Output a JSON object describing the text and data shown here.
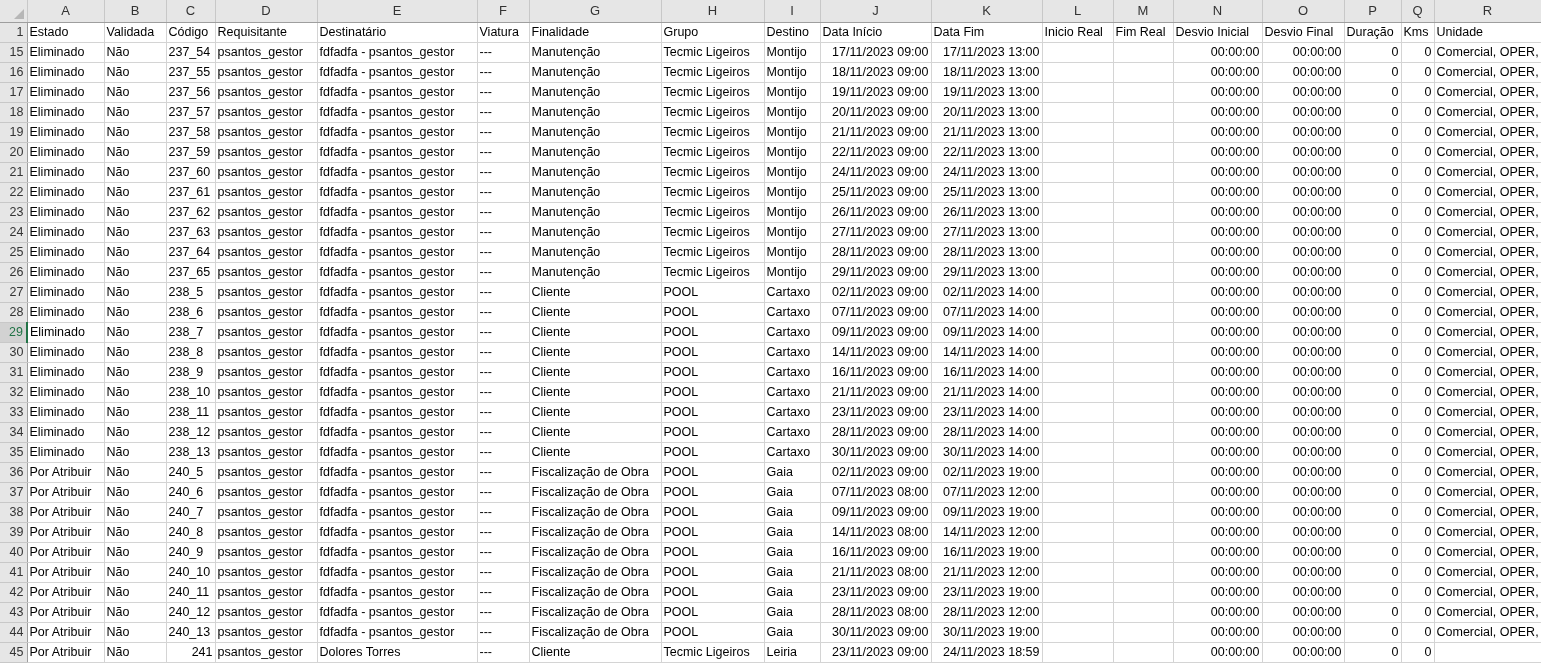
{
  "columns": [
    "A",
    "B",
    "C",
    "D",
    "E",
    "F",
    "G",
    "H",
    "I",
    "J",
    "K",
    "L",
    "M",
    "N",
    "O",
    "P",
    "Q",
    "R"
  ],
  "header_row": {
    "number": "1",
    "selected": false,
    "cells": [
      "Estado",
      "Validada",
      "Código",
      "Requisitante",
      "Destinatário",
      "Viatura",
      "Finalidade",
      "Grupo",
      "Destino",
      "Data Início",
      "Data Fim",
      "Inicio Real",
      "Fim Real",
      "Desvio Inicial",
      "Desvio Final",
      "Duração",
      "Kms",
      "Unidade"
    ]
  },
  "rows": [
    {
      "number": "15",
      "selected": false,
      "cells": [
        "Eliminado",
        "Não",
        "237_54",
        "psantos_gestor",
        "fdfadfa - psantos_gestor",
        "---",
        "Manutenção",
        "Tecmic Ligeiros",
        "Montijo",
        "17/11/2023 09:00",
        "17/11/2023 13:00",
        null,
        null,
        "00:00:00",
        "00:00:00",
        "0",
        "0",
        "Comercial, OPER,"
      ]
    },
    {
      "number": "16",
      "selected": false,
      "cells": [
        "Eliminado",
        "Não",
        "237_55",
        "psantos_gestor",
        "fdfadfa - psantos_gestor",
        "---",
        "Manutenção",
        "Tecmic Ligeiros",
        "Montijo",
        "18/11/2023 09:00",
        "18/11/2023 13:00",
        null,
        null,
        "00:00:00",
        "00:00:00",
        "0",
        "0",
        "Comercial, OPER,"
      ]
    },
    {
      "number": "17",
      "selected": false,
      "cells": [
        "Eliminado",
        "Não",
        "237_56",
        "psantos_gestor",
        "fdfadfa - psantos_gestor",
        "---",
        "Manutenção",
        "Tecmic Ligeiros",
        "Montijo",
        "19/11/2023 09:00",
        "19/11/2023 13:00",
        null,
        null,
        "00:00:00",
        "00:00:00",
        "0",
        "0",
        "Comercial, OPER,"
      ]
    },
    {
      "number": "18",
      "selected": false,
      "cells": [
        "Eliminado",
        "Não",
        "237_57",
        "psantos_gestor",
        "fdfadfa - psantos_gestor",
        "---",
        "Manutenção",
        "Tecmic Ligeiros",
        "Montijo",
        "20/11/2023 09:00",
        "20/11/2023 13:00",
        null,
        null,
        "00:00:00",
        "00:00:00",
        "0",
        "0",
        "Comercial, OPER,"
      ]
    },
    {
      "number": "19",
      "selected": false,
      "cells": [
        "Eliminado",
        "Não",
        "237_58",
        "psantos_gestor",
        "fdfadfa - psantos_gestor",
        "---",
        "Manutenção",
        "Tecmic Ligeiros",
        "Montijo",
        "21/11/2023 09:00",
        "21/11/2023 13:00",
        null,
        null,
        "00:00:00",
        "00:00:00",
        "0",
        "0",
        "Comercial, OPER,"
      ]
    },
    {
      "number": "20",
      "selected": false,
      "cells": [
        "Eliminado",
        "Não",
        "237_59",
        "psantos_gestor",
        "fdfadfa - psantos_gestor",
        "---",
        "Manutenção",
        "Tecmic Ligeiros",
        "Montijo",
        "22/11/2023 09:00",
        "22/11/2023 13:00",
        null,
        null,
        "00:00:00",
        "00:00:00",
        "0",
        "0",
        "Comercial, OPER,"
      ]
    },
    {
      "number": "21",
      "selected": false,
      "cells": [
        "Eliminado",
        "Não",
        "237_60",
        "psantos_gestor",
        "fdfadfa - psantos_gestor",
        "---",
        "Manutenção",
        "Tecmic Ligeiros",
        "Montijo",
        "24/11/2023 09:00",
        "24/11/2023 13:00",
        null,
        null,
        "00:00:00",
        "00:00:00",
        "0",
        "0",
        "Comercial, OPER,"
      ]
    },
    {
      "number": "22",
      "selected": false,
      "cells": [
        "Eliminado",
        "Não",
        "237_61",
        "psantos_gestor",
        "fdfadfa - psantos_gestor",
        "---",
        "Manutenção",
        "Tecmic Ligeiros",
        "Montijo",
        "25/11/2023 09:00",
        "25/11/2023 13:00",
        null,
        null,
        "00:00:00",
        "00:00:00",
        "0",
        "0",
        "Comercial, OPER,"
      ]
    },
    {
      "number": "23",
      "selected": false,
      "cells": [
        "Eliminado",
        "Não",
        "237_62",
        "psantos_gestor",
        "fdfadfa - psantos_gestor",
        "---",
        "Manutenção",
        "Tecmic Ligeiros",
        "Montijo",
        "26/11/2023 09:00",
        "26/11/2023 13:00",
        null,
        null,
        "00:00:00",
        "00:00:00",
        "0",
        "0",
        "Comercial, OPER,"
      ]
    },
    {
      "number": "24",
      "selected": false,
      "cells": [
        "Eliminado",
        "Não",
        "237_63",
        "psantos_gestor",
        "fdfadfa - psantos_gestor",
        "---",
        "Manutenção",
        "Tecmic Ligeiros",
        "Montijo",
        "27/11/2023 09:00",
        "27/11/2023 13:00",
        null,
        null,
        "00:00:00",
        "00:00:00",
        "0",
        "0",
        "Comercial, OPER,"
      ]
    },
    {
      "number": "25",
      "selected": false,
      "cells": [
        "Eliminado",
        "Não",
        "237_64",
        "psantos_gestor",
        "fdfadfa - psantos_gestor",
        "---",
        "Manutenção",
        "Tecmic Ligeiros",
        "Montijo",
        "28/11/2023 09:00",
        "28/11/2023 13:00",
        null,
        null,
        "00:00:00",
        "00:00:00",
        "0",
        "0",
        "Comercial, OPER,"
      ]
    },
    {
      "number": "26",
      "selected": false,
      "cells": [
        "Eliminado",
        "Não",
        "237_65",
        "psantos_gestor",
        "fdfadfa - psantos_gestor",
        "---",
        "Manutenção",
        "Tecmic Ligeiros",
        "Montijo",
        "29/11/2023 09:00",
        "29/11/2023 13:00",
        null,
        null,
        "00:00:00",
        "00:00:00",
        "0",
        "0",
        "Comercial, OPER,"
      ]
    },
    {
      "number": "27",
      "selected": false,
      "cells": [
        "Eliminado",
        "Não",
        "238_5",
        "psantos_gestor",
        "fdfadfa - psantos_gestor",
        "---",
        "Cliente",
        "POOL",
        "Cartaxo",
        "02/11/2023 09:00",
        "02/11/2023 14:00",
        null,
        null,
        "00:00:00",
        "00:00:00",
        "0",
        "0",
        "Comercial, OPER,"
      ]
    },
    {
      "number": "28",
      "selected": false,
      "cells": [
        "Eliminado",
        "Não",
        "238_6",
        "psantos_gestor",
        "fdfadfa - psantos_gestor",
        "---",
        "Cliente",
        "POOL",
        "Cartaxo",
        "07/11/2023 09:00",
        "07/11/2023 14:00",
        null,
        null,
        "00:00:00",
        "00:00:00",
        "0",
        "0",
        "Comercial, OPER,"
      ]
    },
    {
      "number": "29",
      "selected": true,
      "cells": [
        "Eliminado",
        "Não",
        "238_7",
        "psantos_gestor",
        "fdfadfa - psantos_gestor",
        "---",
        "Cliente",
        "POOL",
        "Cartaxo",
        "09/11/2023 09:00",
        "09/11/2023 14:00",
        null,
        null,
        "00:00:00",
        "00:00:00",
        "0",
        "0",
        "Comercial, OPER,"
      ]
    },
    {
      "number": "30",
      "selected": false,
      "cells": [
        "Eliminado",
        "Não",
        "238_8",
        "psantos_gestor",
        "fdfadfa - psantos_gestor",
        "---",
        "Cliente",
        "POOL",
        "Cartaxo",
        "14/11/2023 09:00",
        "14/11/2023 14:00",
        null,
        null,
        "00:00:00",
        "00:00:00",
        "0",
        "0",
        "Comercial, OPER,"
      ]
    },
    {
      "number": "31",
      "selected": false,
      "cells": [
        "Eliminado",
        "Não",
        "238_9",
        "psantos_gestor",
        "fdfadfa - psantos_gestor",
        "---",
        "Cliente",
        "POOL",
        "Cartaxo",
        "16/11/2023 09:00",
        "16/11/2023 14:00",
        null,
        null,
        "00:00:00",
        "00:00:00",
        "0",
        "0",
        "Comercial, OPER,"
      ]
    },
    {
      "number": "32",
      "selected": false,
      "cells": [
        "Eliminado",
        "Não",
        "238_10",
        "psantos_gestor",
        "fdfadfa - psantos_gestor",
        "---",
        "Cliente",
        "POOL",
        "Cartaxo",
        "21/11/2023 09:00",
        "21/11/2023 14:00",
        null,
        null,
        "00:00:00",
        "00:00:00",
        "0",
        "0",
        "Comercial, OPER,"
      ]
    },
    {
      "number": "33",
      "selected": false,
      "cells": [
        "Eliminado",
        "Não",
        "238_11",
        "psantos_gestor",
        "fdfadfa - psantos_gestor",
        "---",
        "Cliente",
        "POOL",
        "Cartaxo",
        "23/11/2023 09:00",
        "23/11/2023 14:00",
        null,
        null,
        "00:00:00",
        "00:00:00",
        "0",
        "0",
        "Comercial, OPER,"
      ]
    },
    {
      "number": "34",
      "selected": false,
      "cells": [
        "Eliminado",
        "Não",
        "238_12",
        "psantos_gestor",
        "fdfadfa - psantos_gestor",
        "---",
        "Cliente",
        "POOL",
        "Cartaxo",
        "28/11/2023 09:00",
        "28/11/2023 14:00",
        null,
        null,
        "00:00:00",
        "00:00:00",
        "0",
        "0",
        "Comercial, OPER,"
      ]
    },
    {
      "number": "35",
      "selected": false,
      "cells": [
        "Eliminado",
        "Não",
        "238_13",
        "psantos_gestor",
        "fdfadfa - psantos_gestor",
        "---",
        "Cliente",
        "POOL",
        "Cartaxo",
        "30/11/2023 09:00",
        "30/11/2023 14:00",
        null,
        null,
        "00:00:00",
        "00:00:00",
        "0",
        "0",
        "Comercial, OPER,"
      ]
    },
    {
      "number": "36",
      "selected": false,
      "cells": [
        "Por Atribuir",
        "Não",
        "240_5",
        "psantos_gestor",
        "fdfadfa - psantos_gestor",
        "---",
        "Fiscalização de Obra",
        "POOL",
        "Gaia",
        "02/11/2023 09:00",
        "02/11/2023 19:00",
        null,
        null,
        "00:00:00",
        "00:00:00",
        "0",
        "0",
        "Comercial, OPER,"
      ]
    },
    {
      "number": "37",
      "selected": false,
      "cells": [
        "Por Atribuir",
        "Não",
        "240_6",
        "psantos_gestor",
        "fdfadfa - psantos_gestor",
        "---",
        "Fiscalização de Obra",
        "POOL",
        "Gaia",
        "07/11/2023 08:00",
        "07/11/2023 12:00",
        null,
        null,
        "00:00:00",
        "00:00:00",
        "0",
        "0",
        "Comercial, OPER,"
      ]
    },
    {
      "number": "38",
      "selected": false,
      "cells": [
        "Por Atribuir",
        "Não",
        "240_7",
        "psantos_gestor",
        "fdfadfa - psantos_gestor",
        "---",
        "Fiscalização de Obra",
        "POOL",
        "Gaia",
        "09/11/2023 09:00",
        "09/11/2023 19:00",
        null,
        null,
        "00:00:00",
        "00:00:00",
        "0",
        "0",
        "Comercial, OPER,"
      ]
    },
    {
      "number": "39",
      "selected": false,
      "cells": [
        "Por Atribuir",
        "Não",
        "240_8",
        "psantos_gestor",
        "fdfadfa - psantos_gestor",
        "---",
        "Fiscalização de Obra",
        "POOL",
        "Gaia",
        "14/11/2023 08:00",
        "14/11/2023 12:00",
        null,
        null,
        "00:00:00",
        "00:00:00",
        "0",
        "0",
        "Comercial, OPER,"
      ]
    },
    {
      "number": "40",
      "selected": false,
      "cells": [
        "Por Atribuir",
        "Não",
        "240_9",
        "psantos_gestor",
        "fdfadfa - psantos_gestor",
        "---",
        "Fiscalização de Obra",
        "POOL",
        "Gaia",
        "16/11/2023 09:00",
        "16/11/2023 19:00",
        null,
        null,
        "00:00:00",
        "00:00:00",
        "0",
        "0",
        "Comercial, OPER,"
      ]
    },
    {
      "number": "41",
      "selected": false,
      "cells": [
        "Por Atribuir",
        "Não",
        "240_10",
        "psantos_gestor",
        "fdfadfa - psantos_gestor",
        "---",
        "Fiscalização de Obra",
        "POOL",
        "Gaia",
        "21/11/2023 08:00",
        "21/11/2023 12:00",
        null,
        null,
        "00:00:00",
        "00:00:00",
        "0",
        "0",
        "Comercial, OPER,"
      ]
    },
    {
      "number": "42",
      "selected": false,
      "cells": [
        "Por Atribuir",
        "Não",
        "240_11",
        "psantos_gestor",
        "fdfadfa - psantos_gestor",
        "---",
        "Fiscalização de Obra",
        "POOL",
        "Gaia",
        "23/11/2023 09:00",
        "23/11/2023 19:00",
        null,
        null,
        "00:00:00",
        "00:00:00",
        "0",
        "0",
        "Comercial, OPER,"
      ]
    },
    {
      "number": "43",
      "selected": false,
      "cells": [
        "Por Atribuir",
        "Não",
        "240_12",
        "psantos_gestor",
        "fdfadfa - psantos_gestor",
        "---",
        "Fiscalização de Obra",
        "POOL",
        "Gaia",
        "28/11/2023 08:00",
        "28/11/2023 12:00",
        null,
        null,
        "00:00:00",
        "00:00:00",
        "0",
        "0",
        "Comercial, OPER,"
      ]
    },
    {
      "number": "44",
      "selected": false,
      "cells": [
        "Por Atribuir",
        "Não",
        "240_13",
        "psantos_gestor",
        "fdfadfa - psantos_gestor",
        "---",
        "Fiscalização de Obra",
        "POOL",
        "Gaia",
        "30/11/2023 09:00",
        "30/11/2023 19:00",
        null,
        null,
        "00:00:00",
        "00:00:00",
        "0",
        "0",
        "Comercial, OPER,"
      ]
    },
    {
      "number": "45",
      "selected": false,
      "cells": [
        "Por Atribuir",
        "Não",
        "241",
        "psantos_gestor",
        "Dolores Torres",
        "---",
        "Cliente",
        "Tecmic Ligeiros",
        "Leiria",
        "23/11/2023 09:00",
        "24/11/2023 18:59",
        null,
        null,
        "00:00:00",
        "00:00:00",
        "0",
        "0",
        null
      ]
    }
  ]
}
